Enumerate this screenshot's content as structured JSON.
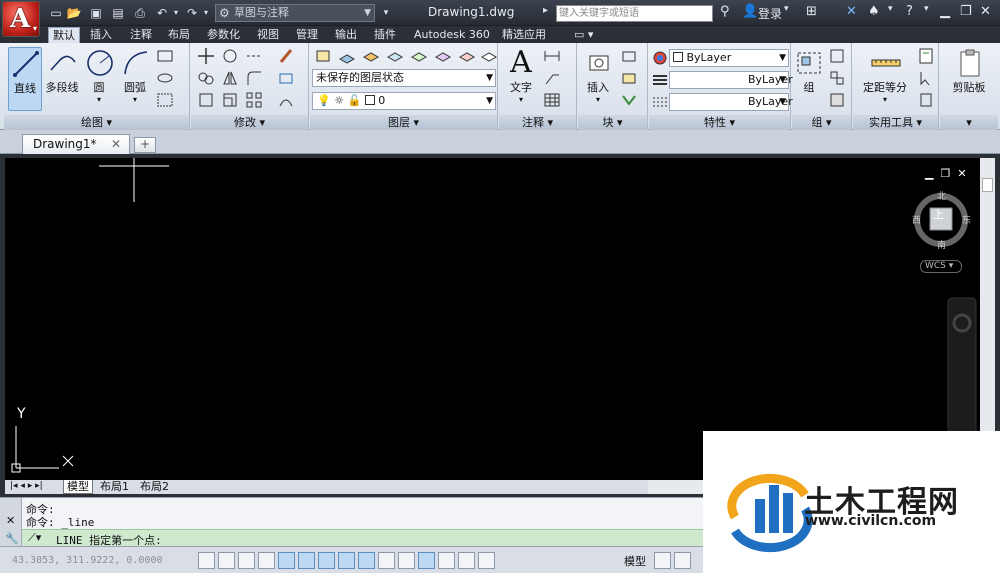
{
  "app": {
    "logo_letter": "A",
    "doc_title": "Drawing1.dwg",
    "workspace": "草图与注释",
    "search_placeholder": "键入关键字或短语",
    "login": "登录"
  },
  "ribbon_tabs": [
    "默认",
    "插入",
    "注释",
    "布局",
    "参数化",
    "视图",
    "管理",
    "输出",
    "插件",
    "Autodesk 360",
    "精选应用"
  ],
  "ribbon": {
    "draw": {
      "title": "绘图",
      "tools": [
        "直线",
        "多段线",
        "圆",
        "圆弧"
      ]
    },
    "modify": {
      "title": "修改"
    },
    "layers": {
      "title": "图层",
      "state": "未保存的图层状态",
      "current": "0"
    },
    "annotation": {
      "title": "注释",
      "text": "文字"
    },
    "block": {
      "title": "块",
      "insert": "插入"
    },
    "properties": {
      "title": "特性",
      "color": "ByLayer",
      "linetype": "ByLayer",
      "lineweight": "ByLayer"
    },
    "groups": {
      "title": "组",
      "group": "组"
    },
    "utilities": {
      "title": "实用工具",
      "measure": "定距等分"
    },
    "clipboard": {
      "title": "",
      "paste": "剪贴板"
    }
  },
  "doc_tab": {
    "name": "Drawing1*"
  },
  "viewcube": {
    "north": "北",
    "south": "南",
    "west": "西",
    "east": "东",
    "top": "上",
    "wcs": "WCS"
  },
  "ucs": {
    "y": "Y",
    "x": "X"
  },
  "layout_tabs": [
    "模型",
    "布局1",
    "布局2"
  ],
  "command": {
    "history": [
      "命令:",
      "命令: _line"
    ],
    "prompt": "LINE 指定第一个点:"
  },
  "status": {
    "coords": "43.3053, 311.9222, 0.0000",
    "model": "模型"
  },
  "watermark": {
    "cn": "土木工程网",
    "url": "www.civilcn.com"
  }
}
